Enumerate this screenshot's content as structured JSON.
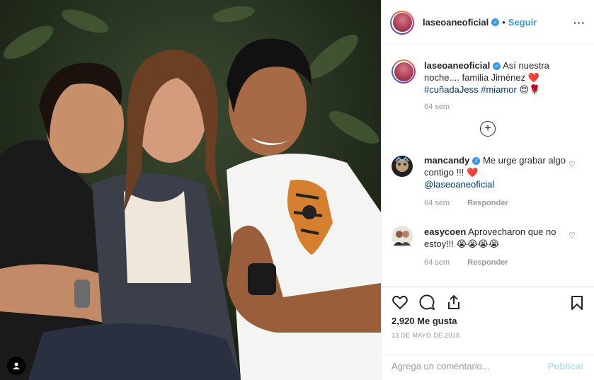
{
  "header": {
    "username": "laseoaneoficial",
    "verified_icon": "verified-badge-icon",
    "separator": "•",
    "follow_label": "Seguir",
    "more_icon": "more-options-icon",
    "more_glyph": "···"
  },
  "caption": {
    "username": "laseoaneoficial",
    "text": "Así nuestra noche.... familia Jiménez",
    "emoji1": "❤️",
    "hashtag1": "#cuñadaJess",
    "hashtag2": "#miamor",
    "emoji2": "😍🌹",
    "time": "64 sem"
  },
  "load_more": {
    "glyph": "+"
  },
  "comments": [
    {
      "username": "mancandy",
      "verified": true,
      "text": "Me urge grabar algo contigo !!!",
      "emoji": "❤️",
      "mention": "@laseoaneoficial",
      "time": "64 sem",
      "reply": "Responder"
    },
    {
      "username": "easycoen",
      "verified": false,
      "text": "Aprovecharon que no estoy!!!",
      "emoji": "😭😭😭😭",
      "time": "64 sem",
      "reply": "Responder"
    }
  ],
  "actions": {
    "like_icon": "heart-icon",
    "comment_icon": "comment-icon",
    "share_icon": "share-icon",
    "save_icon": "bookmark-icon",
    "likes": "2,920 Me gusta",
    "date": "13 DE MAYO DE 2018"
  },
  "add_comment": {
    "placeholder": "Agrega un comentario...",
    "publish_label": "Publicar"
  },
  "colors": {
    "link": "#3897f0",
    "hashtag": "#003569",
    "muted": "#999999",
    "publish_disabled": "#b2dffc"
  }
}
